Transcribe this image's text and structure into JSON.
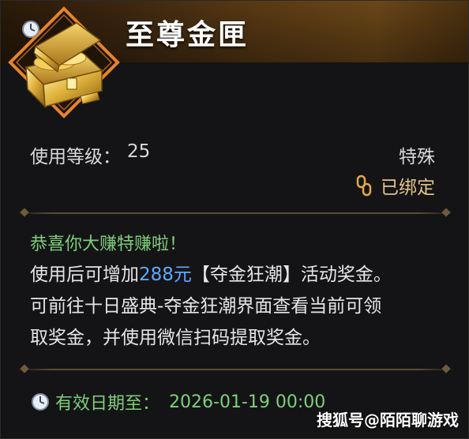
{
  "item": {
    "name": "至尊金匣",
    "level_label": "使用等级：",
    "level_value": "25",
    "rarity": "特殊",
    "bound_label": "已绑定"
  },
  "description": {
    "congrats": "恭喜你大赚特赚啦！",
    "line1_prefix": "使用后可增加",
    "amount": "288元",
    "line1_suffix": "【夺金狂潮】活动奖金。",
    "line2": "可前往十日盛典-夺金狂潮界面查看当前可领",
    "line3": "取奖金，并使用微信扫码提取奖金。"
  },
  "validity": {
    "label": "有效日期至：",
    "date": "2026-01-19 00:00"
  },
  "watermark": "搜狐号@陌陌聊游戏",
  "colors": {
    "title": "#ffffff",
    "green_text": "#7fcf7a",
    "amount_blue": "#5fa9ff",
    "bound_gold": "#e0c38a",
    "frame_orange": "#e8832a"
  },
  "icons": {
    "item": "golden-treasure-chest-icon",
    "clock": "clock-icon",
    "bound": "chain-link-icon"
  }
}
